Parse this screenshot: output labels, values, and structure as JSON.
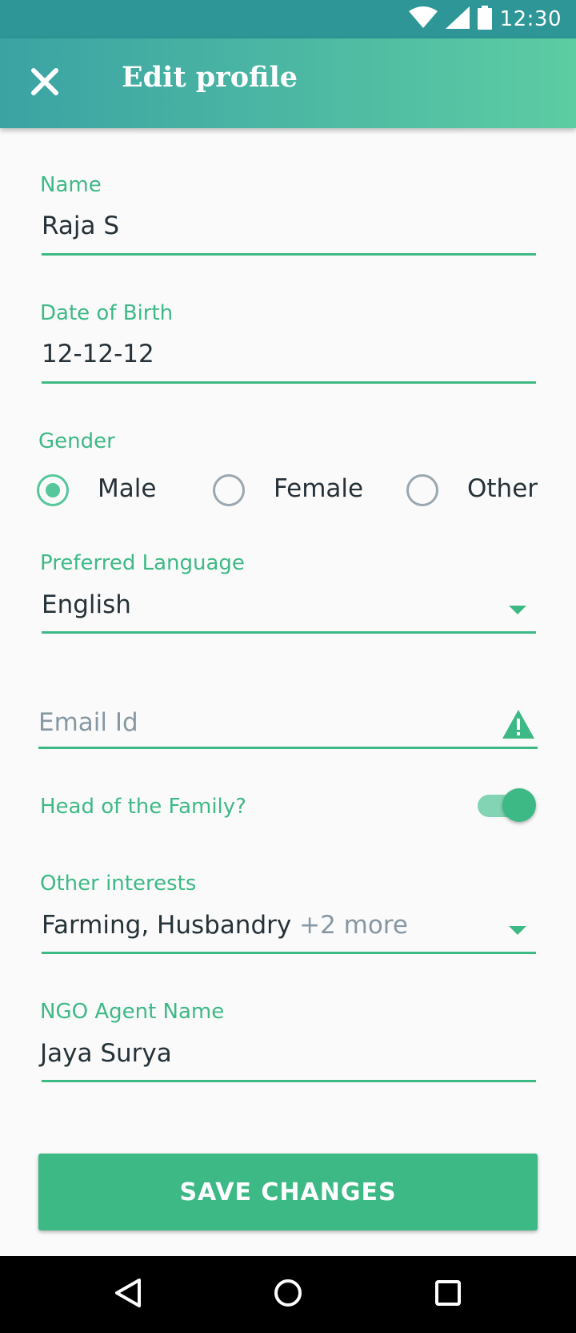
{
  "status_bar": {
    "time": "12:30",
    "icons": [
      "wifi-icon",
      "signal-icon",
      "battery-icon"
    ]
  },
  "app_bar": {
    "title": "Edit profile",
    "close_icon": "close-icon"
  },
  "form": {
    "name": {
      "label": "Name",
      "value": "Raja S"
    },
    "dob": {
      "label": "Date of Birth",
      "value": "12-12-12"
    },
    "gender": {
      "label": "Gender",
      "options": [
        "Male",
        "Female",
        "Other"
      ],
      "selected": "Male"
    },
    "language": {
      "label": "Preferred Language",
      "value": "English"
    },
    "email": {
      "placeholder": "Email Id",
      "warning_icon": "warning-icon"
    },
    "head_of_family": {
      "label": "Head of the Family?",
      "enabled": true
    },
    "interests": {
      "label": "Other interests",
      "value": "Farming, Husbandry",
      "more": "+2 more"
    },
    "ngo_agent": {
      "label": "NGO Agent Name",
      "value": "Jaya Surya"
    }
  },
  "save_button": {
    "label": "SAVE CHANGES"
  },
  "nav_bar": {
    "icons": [
      "back-icon",
      "home-icon",
      "recents-icon"
    ]
  },
  "colors": {
    "accent": "#3db986",
    "status_bar": "#2e9696",
    "app_bar_start": "#3ba3a3",
    "app_bar_end": "#5ccca3"
  }
}
